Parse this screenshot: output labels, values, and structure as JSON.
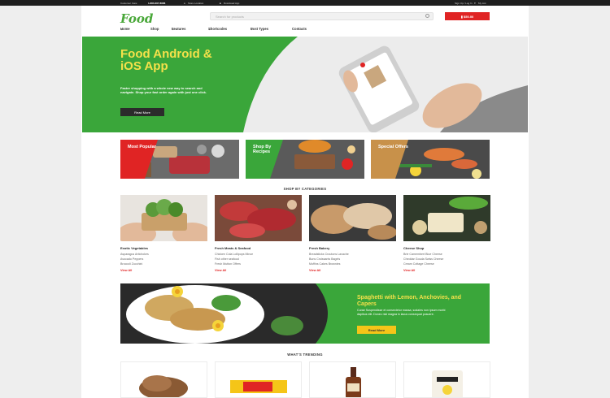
{
  "topbar": {
    "phone_label": "Customer Care:",
    "phone": "1-800-307-8086",
    "store": "Store Location",
    "download": "Download App",
    "signup": "Sign Up / Log In",
    "wishlist": "My List"
  },
  "header": {
    "logo": "Food",
    "search_placeholder": "Search for products",
    "cart": "$50.00"
  },
  "nav": {
    "items": [
      "Home",
      "Shop",
      "Features",
      "Shortcodes",
      "Post Types",
      "Contacts"
    ]
  },
  "hero": {
    "title": "Food Android & iOS App",
    "text": "Faster shopping with a whole new way to search and navigate. Shop your fast order again with just one click.",
    "button": "Read More"
  },
  "promos": [
    {
      "label": "Most Popular",
      "color": "#e02424"
    },
    {
      "label": "Shop By Recipes",
      "color": "#3aa63a"
    },
    {
      "label": "Special Offers",
      "color": "#c8914a"
    }
  ],
  "categories_title": "SHOP BY CATEGORIES",
  "categories": [
    {
      "title": "Exotic Vegetables",
      "links": [
        "Asparagus Artichokes",
        "Avocado Peppers",
        "Broccoli Zucchini"
      ],
      "view": "View All"
    },
    {
      "title": "Fresh Meats & Seafood",
      "links": [
        "Chicken Cola Lollipops Mince",
        "Fish other seafood",
        "Fresh Mutton Offers"
      ],
      "view": "View All"
    },
    {
      "title": "Fresh Bakery",
      "links": [
        "Breadsticks Croutons Lavache",
        "Buns Croissants Bagels",
        "Muffins Cakes Brownies"
      ],
      "view": "View All"
    },
    {
      "title": "Cheese Shop",
      "links": [
        "Brie Camembert Blue Cheese",
        "Cheddar Gouda Swiss Cheese",
        "Cream Cottage Cheese"
      ],
      "view": "View All"
    }
  ],
  "feature": {
    "title": "Spaghetti with Lemon, Anchovies, and Capers",
    "text": "Curae Suspendisse et consectetur massa, sodales non ipsum morbi dapibus elit. Donec nisl magna in lacus consequat posuere.",
    "button": "Read More"
  },
  "trending_title": "WHAT'S TRENDING",
  "colors": {
    "brand_green": "#3aa63a",
    "accent_red": "#e02424",
    "accent_yellow": "#f5e14a"
  }
}
